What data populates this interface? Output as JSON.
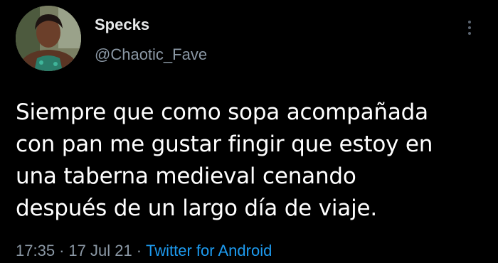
{
  "author": {
    "display_name": "Specks",
    "handle": "@Chaotic_Fave"
  },
  "tweet": {
    "lines": [
      "Siempre que como sopa acompañada",
      "con pan me gustar fingir que estoy en",
      "una taberna medieval cenando",
      "después de un largo día de viaje."
    ]
  },
  "meta": {
    "time": "17:35",
    "separator": "·",
    "date": "17 Jul 21",
    "source": "Twitter for Android"
  },
  "icons": {
    "more": "more-vertical-icon",
    "avatar": "profile-photo"
  },
  "colors": {
    "background": "#000000",
    "text": "#ffffff",
    "secondary": "#8b98a5",
    "link": "#1d9bf0"
  }
}
